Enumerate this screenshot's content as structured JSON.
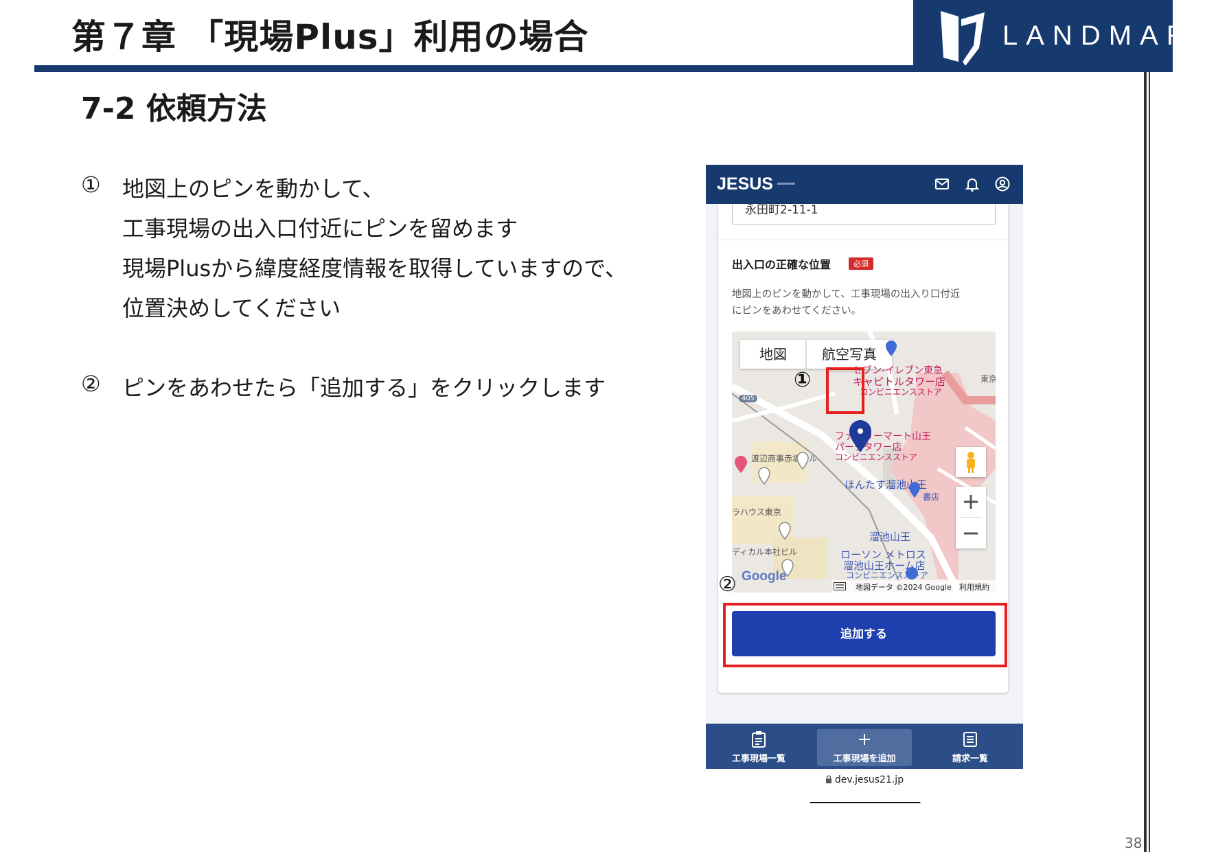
{
  "header": {
    "chapter_title": "第７章 「現場Plus」利用の場合",
    "logo_text": "LANDMARK",
    "brand_color": "#173a6e"
  },
  "section_title": "7-2 依頼方法",
  "steps": [
    {
      "num": "①",
      "lines": [
        "地図上のピンを動かして、",
        "工事現場の出入口付近にピンを留めます",
        "現場Plusから緯度経度情報を取得していますので、",
        "位置決めしてください"
      ]
    },
    {
      "num": "②",
      "lines": [
        "ピンをあわせたら「追加する」をクリックします"
      ]
    }
  ],
  "phone": {
    "app_logo": "JESUS",
    "address_value": "永田町2-11-1",
    "field_label": "出入口の正確な位置",
    "required_badge": "必須",
    "help_line_1": "地図上のピンを動かして、工事現場の出入り口付近",
    "help_line_2": "にピンをあわせてください。",
    "map": {
      "type_buttons": [
        "地図",
        "航空写真"
      ],
      "labels": {
        "poi_1a": "セブン-イレブン東急",
        "poi_1b": "キャピトルタワー店",
        "poi_1c": "コンビニエンスストア",
        "poi_tokyu": "東京",
        "poi_2a": "ファミリーマート山王",
        "poi_2b": "パークタワー店",
        "poi_2c": "コンビニエンスストア",
        "watanabe": "渡辺商事赤坂ビル",
        "hontasu": "ほんたす溜池山王",
        "shoten": "書店",
        "opera": "ラハウス東京",
        "station": "溜池山王",
        "medical": "ディカル本社ビル",
        "lawson_a": "ローソン メトロス",
        "lawson_b": "溜池山王ホーム店",
        "lawson_c": "コンビニエンスストア",
        "route": "405",
        "google": "Google",
        "attribution": "地図データ ©2024 Google",
        "terms": "利用規約"
      }
    },
    "annotation_1": "①",
    "annotation_2": "②",
    "add_button": "追加する",
    "nav": [
      {
        "label": "工事現場一覧",
        "icon": "clipboard-icon"
      },
      {
        "label": "工事現場を追加",
        "icon": "plus-icon"
      },
      {
        "label": "請求一覧",
        "icon": "list-icon"
      }
    ],
    "url": "dev.jesus21.jp",
    "primary_color": "#1f3fae",
    "highlight_color": "#e51f1f"
  },
  "page_number": "38"
}
